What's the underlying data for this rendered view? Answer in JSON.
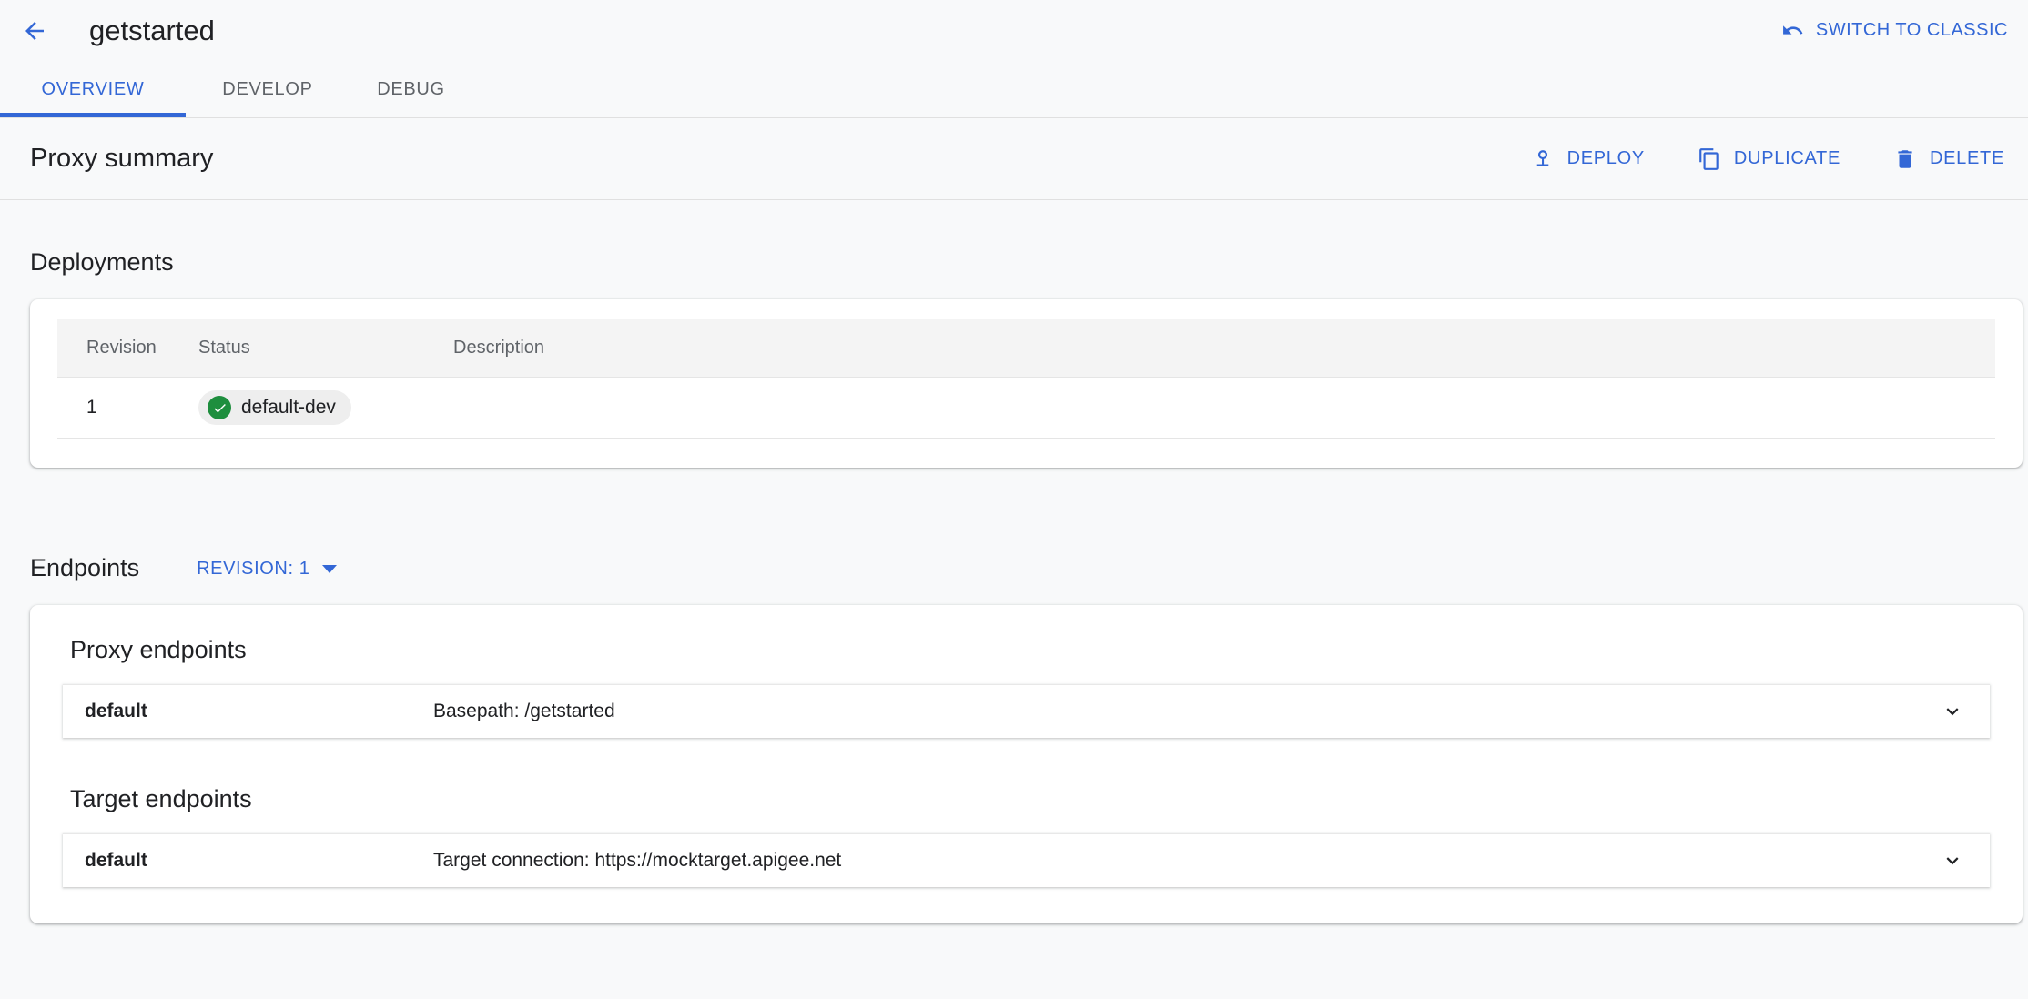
{
  "topbar": {
    "back_icon": "arrow-back-icon",
    "title": "getstarted",
    "switch_classic": {
      "label": "SWITCH TO CLASSIC",
      "icon": "undo-icon"
    }
  },
  "tabs": [
    {
      "label": "OVERVIEW",
      "active": true
    },
    {
      "label": "DEVELOP",
      "active": false
    },
    {
      "label": "DEBUG",
      "active": false
    }
  ],
  "summary": {
    "title": "Proxy summary",
    "actions": [
      {
        "label": "DEPLOY",
        "icon": "deploy-pin-icon"
      },
      {
        "label": "DUPLICATE",
        "icon": "copy-icon"
      },
      {
        "label": "DELETE",
        "icon": "trash-icon"
      }
    ]
  },
  "deployments": {
    "heading": "Deployments",
    "columns": [
      "Revision",
      "Status",
      "Description"
    ],
    "rows": [
      {
        "revision": "1",
        "status": "default-dev",
        "status_icon": "check-circle-icon",
        "description": ""
      }
    ]
  },
  "endpoints": {
    "heading": "Endpoints",
    "revision_selector": "REVISION: 1",
    "revision_caret_icon": "caret-down-icon",
    "groups": [
      {
        "title": "Proxy endpoints",
        "items": [
          {
            "name": "default",
            "detail": "Basepath: /getstarted",
            "chevron_icon": "chevron-down-icon"
          }
        ]
      },
      {
        "title": "Target endpoints",
        "items": [
          {
            "name": "default",
            "detail": "Target connection: https://mocktarget.apigee.net",
            "chevron_icon": "chevron-down-icon"
          }
        ]
      }
    ]
  },
  "colors": {
    "accent_blue": "#3367d6",
    "page_bg": "#f8f9fa",
    "card_bg": "#ffffff",
    "success_green": "#1e8e3e",
    "chip_bg": "#eeeeee",
    "muted_text": "#5f6368",
    "primary_text": "#202124"
  }
}
